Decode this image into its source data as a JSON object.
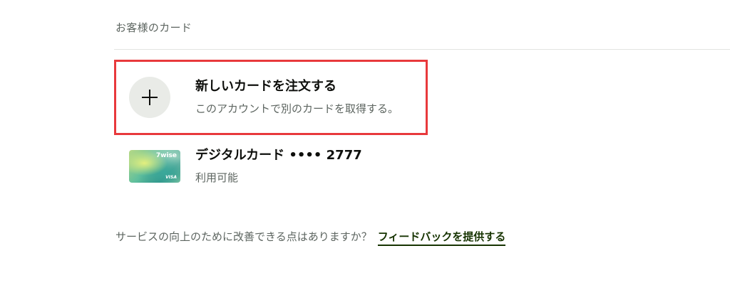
{
  "section": {
    "title": "お客様のカード"
  },
  "order_card": {
    "icon": "plus-icon",
    "title": "新しいカードを注文する",
    "subtitle": "このアカウントで別のカードを取得する。"
  },
  "digital_card": {
    "brand": "7wise",
    "network": "VISA",
    "title": "デジタルカード •••• 2777",
    "status": "利用可能"
  },
  "feedback": {
    "prompt": "サービスの向上のために改善できる点はありますか？",
    "link_label": "フィードバックを提供する"
  },
  "colors": {
    "highlight_border": "#e8393c",
    "link": "#163300",
    "muted_text": "#5d6560",
    "icon_bg": "#e9ebe7"
  }
}
